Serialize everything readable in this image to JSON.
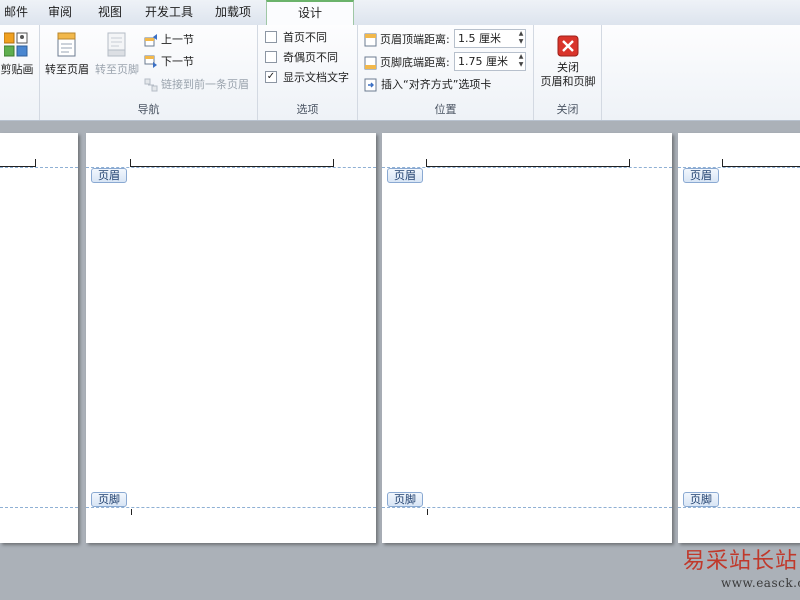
{
  "tabs": [
    "邮件",
    "审阅",
    "视图",
    "开发工具",
    "加载项",
    "设计"
  ],
  "active_tab": "设计",
  "ribbon": {
    "clipboard": {
      "label": "剪贴画"
    },
    "nav": {
      "label": "导航",
      "goto_header": "转至页眉",
      "goto_footer": "转至页脚",
      "prev_section": "上一节",
      "next_section": "下一节",
      "link_previous": "链接到前一条页眉"
    },
    "options": {
      "label": "选项",
      "first_page": {
        "text": "首页不同",
        "checked": false
      },
      "odd_even": {
        "text": "奇偶页不同",
        "checked": false
      },
      "show_text": {
        "text": "显示文档文字",
        "checked": true
      }
    },
    "position": {
      "label": "位置",
      "header_top_label": "页眉顶端距离:",
      "header_top_value": "1.5 厘米",
      "footer_bottom_label": "页脚底端距离:",
      "footer_bottom_value": "1.75 厘米",
      "insert_align": "插入“对齐方式”选项卡"
    },
    "close": {
      "label": "关闭",
      "btn_line1": "关闭",
      "btn_line2": "页眉和页脚"
    }
  },
  "pages": {
    "header_tag": "页眉",
    "footer_tag": "页脚"
  },
  "watermark": {
    "cn": "易采站长站",
    "url": "www.easck.com"
  },
  "colors": {
    "accent_tab": "#6bb36b",
    "close_red": "#d9342b",
    "tag_blue": "#8aa9d2"
  }
}
